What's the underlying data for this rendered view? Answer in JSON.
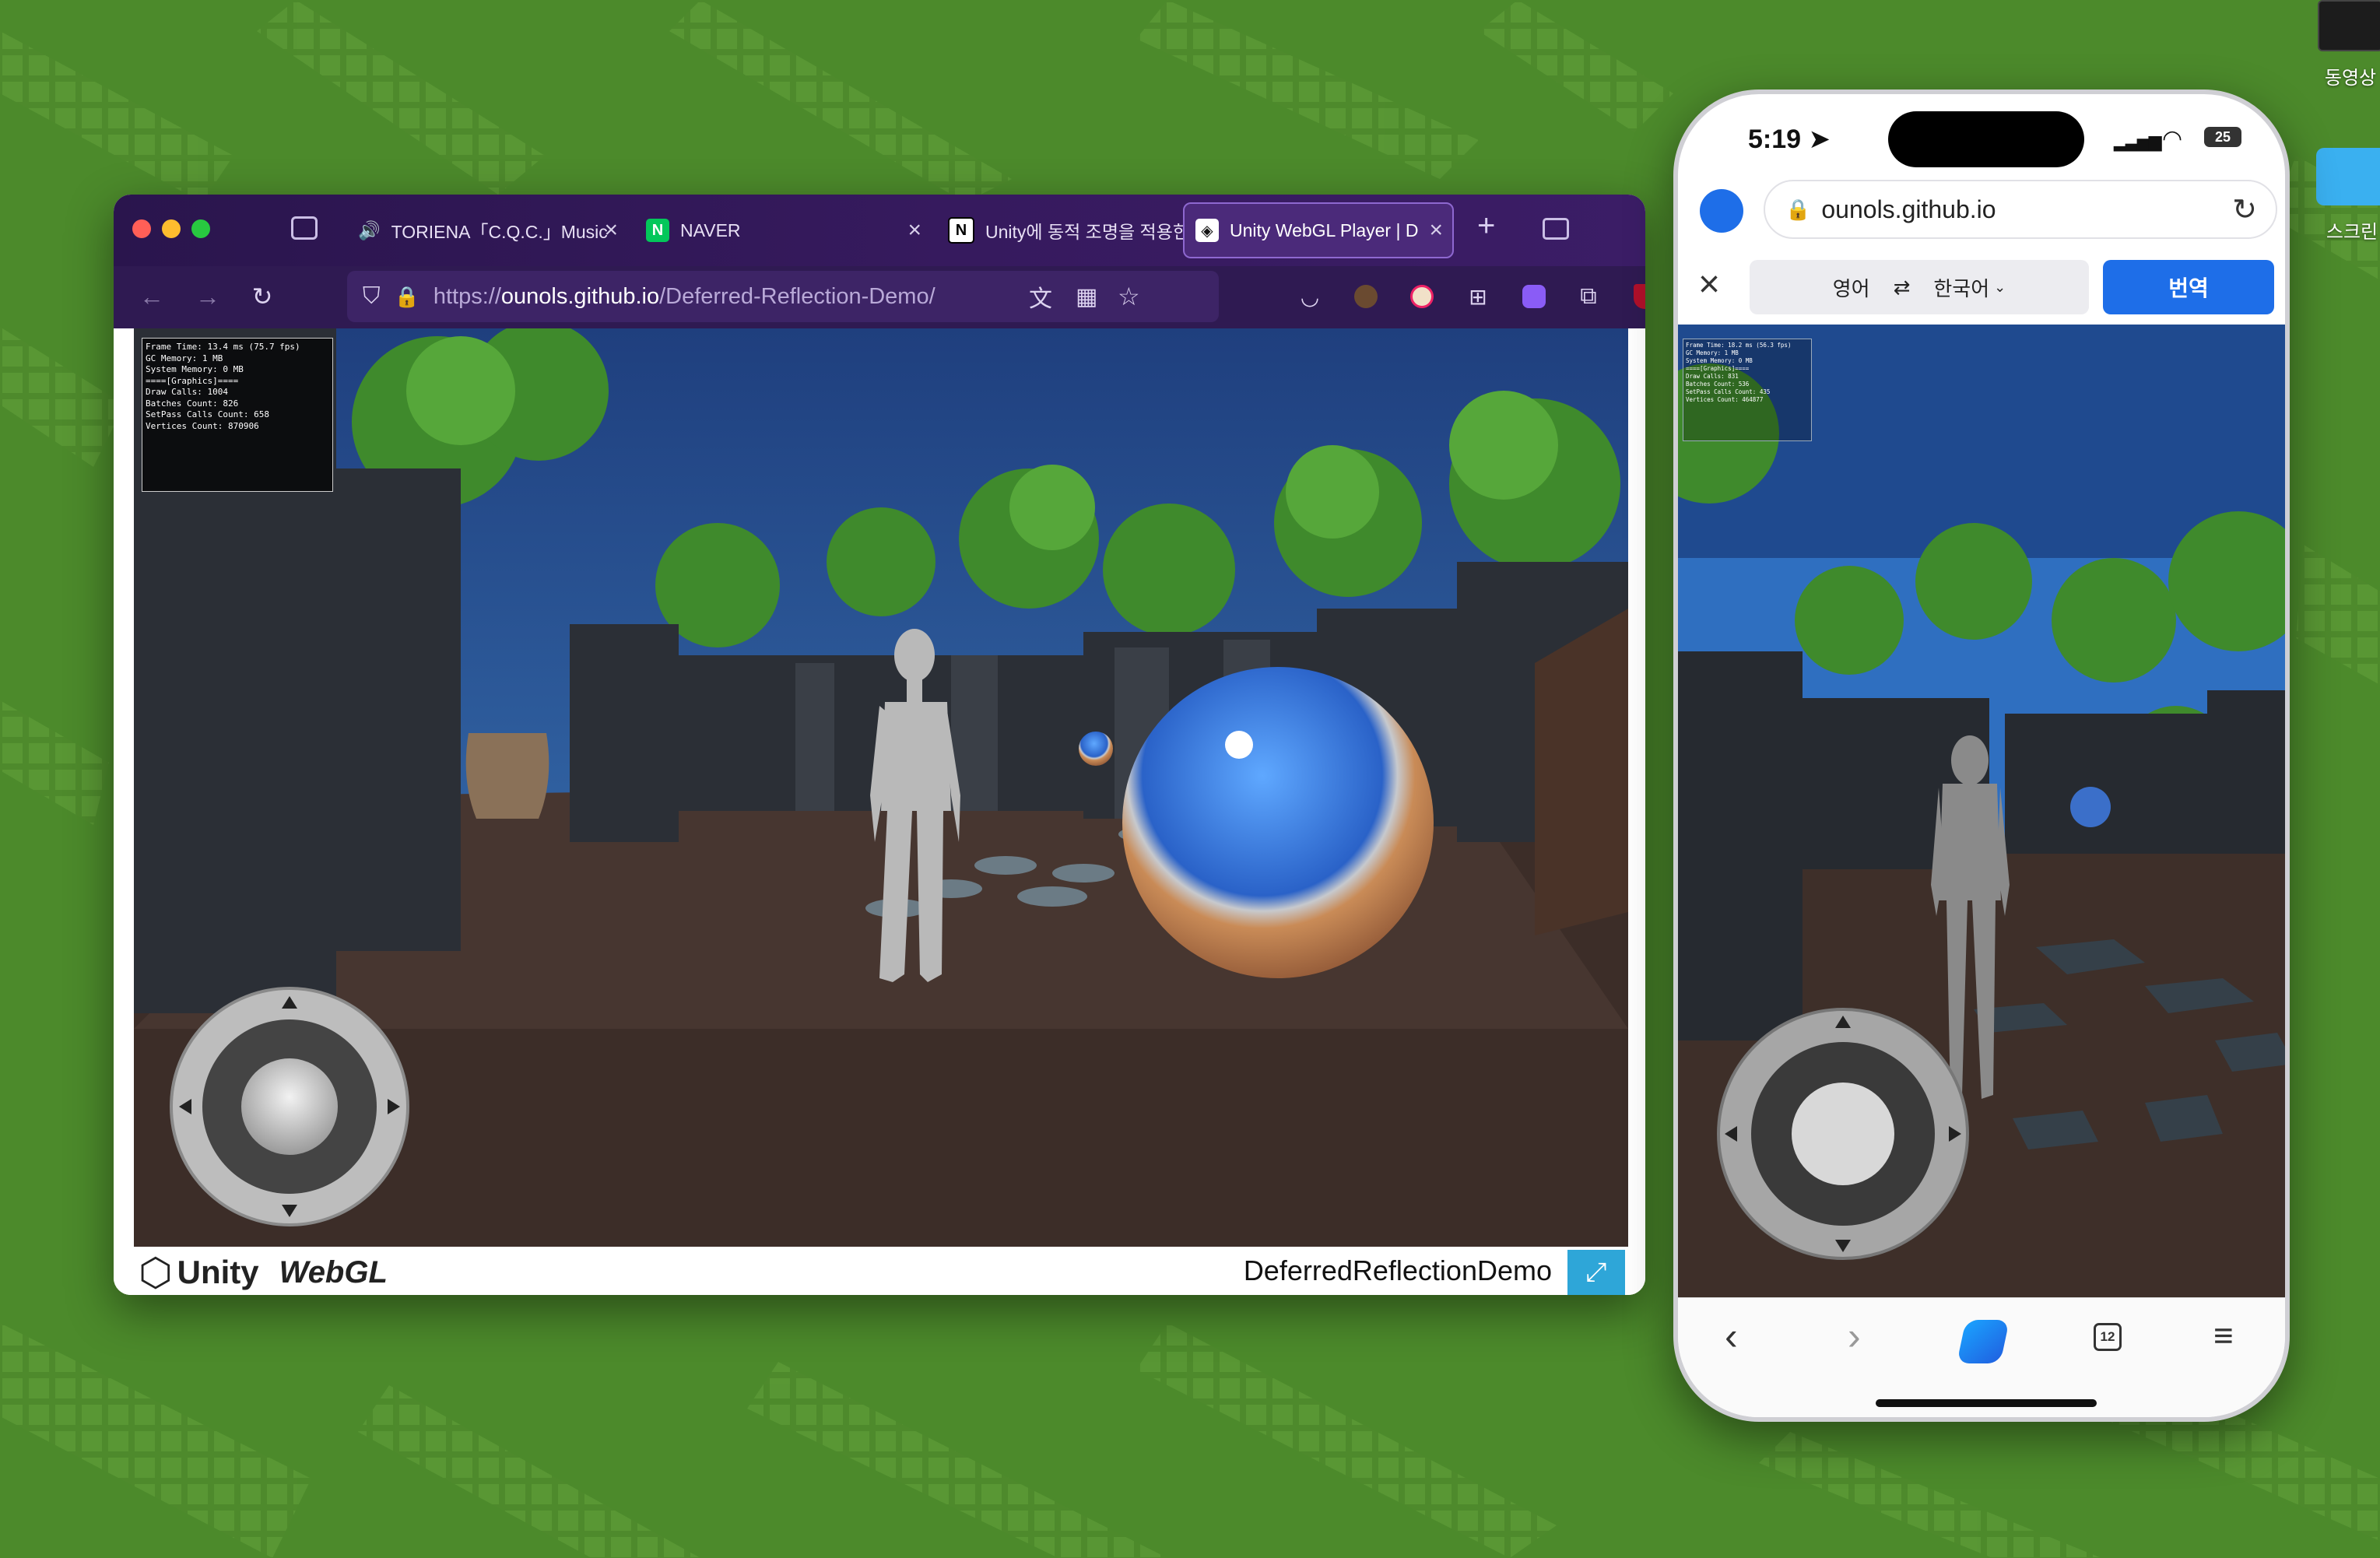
{
  "desktop": {
    "icons": [
      {
        "label": "동영상"
      },
      {
        "label": "스크린"
      }
    ]
  },
  "browser": {
    "tabs": [
      {
        "label": "TORIENA「C.Q.C.」Music",
        "audio": true
      },
      {
        "label": "NAVER"
      },
      {
        "label": "Unity에 동적 조명을 적용한"
      },
      {
        "label": "Unity WebGL Player | D",
        "active": true
      }
    ],
    "url": {
      "prefix": "https://",
      "host": "ounols.github.io",
      "path": "/Deferred-Reflection-Demo/"
    },
    "stats": [
      "Frame Time: 13.4 ms (75.7 fps)",
      "GC Memory: 1 MB",
      "System Memory: 0 MB",
      "====[Graphics]====",
      "Draw Calls: 1004",
      "Batches Count: 826",
      "SetPass Calls Count: 658",
      "Vertices Count: 870906"
    ],
    "footer": {
      "unity_logo": "Unity",
      "webgl_logo": "WebGL",
      "title": "DeferredReflectionDemo"
    }
  },
  "phone": {
    "time": "5:19",
    "battery": "25",
    "address": "ounols.github.io",
    "translate": {
      "from": "영어",
      "to": "한국어",
      "button": "번역"
    },
    "stats": [
      "Frame Time: 18.2 ms (56.3 fps)",
      "GC Memory: 1 MB",
      "System Memory: 0 MB",
      "====[Graphics]====",
      "Draw Calls: 831",
      "Batches Count: 536",
      "SetPass Calls Count: 435",
      "Vertices Count: 464877"
    ],
    "tab_count": "12"
  },
  "colors": {
    "firefox_tabbar": "#2a154d",
    "translate_button": "#1e6ee8",
    "phone_sky": "#2f6fc0"
  }
}
